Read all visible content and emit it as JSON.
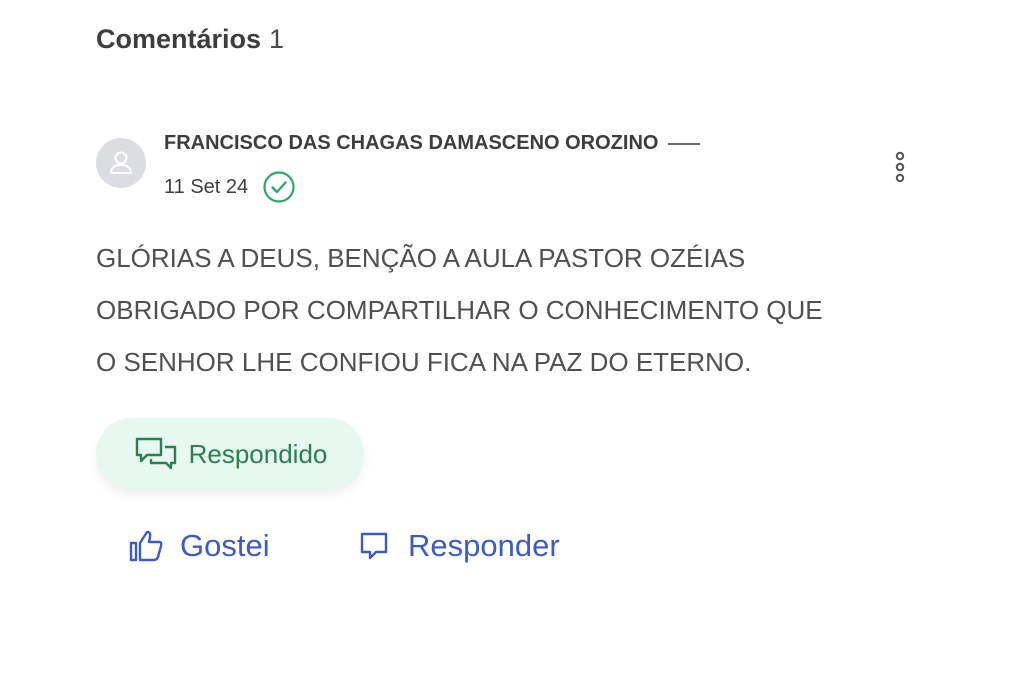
{
  "comments": {
    "title": "Comentários",
    "count": "1",
    "items": [
      {
        "author": "FRANCISCO DAS CHAGAS DAMASCENO OROZINO",
        "date": "11 Set 24",
        "body_lines": [
          "GLÓRIAS A DEUS, BENÇÃO A AULA PASTOR OZÉIAS",
          "OBRIGADO POR COMPARTILHAR O CONHECIMENTO QUE",
          "O SENHOR LHE CONFIOU FICA NA PAZ DO ETERNO."
        ],
        "status_badge": "Respondido",
        "like_label": "Gostei",
        "reply_label": "Responder",
        "icons": {
          "avatar": "user-icon",
          "status": "check-circle-icon",
          "menu": "more-vertical-icon",
          "badge": "chat-bubbles-icon",
          "like": "thumbs-up-icon",
          "reply": "comment-icon"
        }
      }
    ]
  },
  "colors": {
    "heading": "#3d3d3d",
    "body_text": "#505050",
    "accent_blue": "#3d5cc2",
    "success_green": "#2a8050",
    "badge_bg": "#e6f8ef",
    "avatar_bg": "#dcdde0"
  }
}
